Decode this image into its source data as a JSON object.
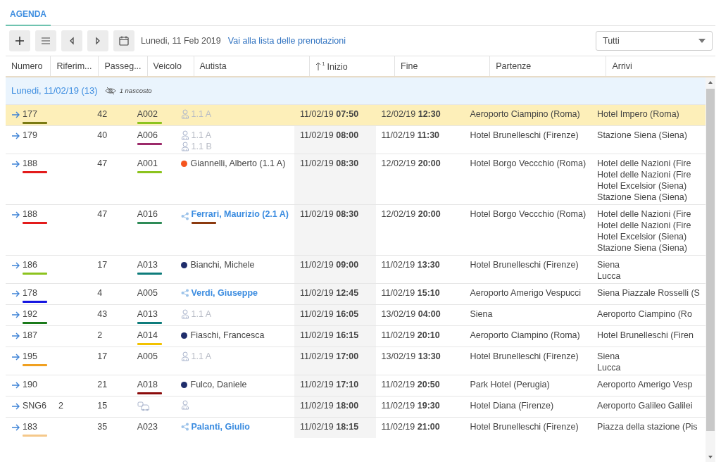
{
  "tabs": [
    {
      "label": "AGENDA",
      "selected": true
    }
  ],
  "toolbar": {
    "date": "Lunedi, 11 Feb 2019",
    "link": "Vai alla lista delle prenotazioni",
    "filter": "Tutti"
  },
  "table": {
    "columns": [
      {
        "label": "Numero"
      },
      {
        "label": "Riferim..."
      },
      {
        "label": "Passeg..."
      },
      {
        "label": "Veicolo"
      },
      {
        "label": "Autista"
      },
      {
        "label": "Inizio",
        "sort_order": "1"
      },
      {
        "label": "Fine"
      },
      {
        "label": "Partenze"
      },
      {
        "label": "Arrivi"
      }
    ],
    "group": {
      "label": "Lunedi, 11/02/19 (13)",
      "hidden": "1 nascosto"
    },
    "rows": [
      {
        "number": {
          "text": "177",
          "color": "#7a7a12"
        },
        "reference": "",
        "passengers": "42",
        "vehicle": {
          "kind": "code",
          "code": "A002",
          "color": "#8cc31e"
        },
        "driver": {
          "kind": "placeholder",
          "slots": [
            "1.1 A"
          ]
        },
        "start": "11/02/19 **07:50**",
        "end": "12/02/19 **12:30**",
        "departure": "Aeroporto Ciampino (Roma)",
        "arrivals": [
          "Hotel Impero (Roma)"
        ],
        "selected": true
      },
      {
        "number": {
          "text": "179"
        },
        "reference": "",
        "passengers": "40",
        "vehicle": {
          "kind": "code",
          "code": "A006",
          "color": "#9c2a6a"
        },
        "driver": {
          "kind": "placeholder",
          "slots": [
            "1.1 A",
            "1.1 B"
          ]
        },
        "start": "11/02/19 **08:00**",
        "end": "11/02/19 **11:30**",
        "departure": "Hotel Brunelleschi (Firenze)",
        "arrivals": [
          "Stazione Siena (Siena)"
        ],
        "selected": false
      },
      {
        "number": {
          "text": "188",
          "color": "#e31b1b"
        },
        "reference": "",
        "passengers": "47",
        "vehicle": {
          "kind": "code",
          "code": "A001",
          "color": "#8cc31e"
        },
        "driver": {
          "kind": "person",
          "name": "Giannelli, Alberto (1.1 A)",
          "color": "#f5541d"
        },
        "start": "11/02/19 **08:30**",
        "end": "12/02/19 **20:00**",
        "departure": "Hotel Borgo Veccchio (Roma)",
        "arrivals": [
          "Hotel delle Nazioni (Fire",
          "Hotel delle Nazioni (Fire",
          "Hotel Excelsior (Siena)",
          "Stazione Siena (Siena)"
        ],
        "selected": false
      },
      {
        "number": {
          "text": "188",
          "color": "#e31b1b"
        },
        "reference": "",
        "passengers": "47",
        "vehicle": {
          "kind": "code",
          "code": "A016",
          "color": "#2e8b57"
        },
        "driver": {
          "kind": "shared",
          "name": "Ferrari, Maurizio (2.1 A)",
          "color": "#8b3a0f"
        },
        "start": "11/02/19 **08:30**",
        "end": "12/02/19 **20:00**",
        "departure": "Hotel Borgo Veccchio (Roma)",
        "arrivals": [
          "Hotel delle Nazioni (Fire",
          "Hotel delle Nazioni (Fire",
          "Hotel Excelsior (Siena)",
          "Stazione Siena (Siena)"
        ],
        "selected": false
      },
      {
        "number": {
          "text": "186",
          "color": "#8cc31e"
        },
        "reference": "",
        "passengers": "17",
        "vehicle": {
          "kind": "code",
          "code": "A013",
          "color": "#0e7c7b"
        },
        "driver": {
          "kind": "person",
          "name": "Bianchi, Michele",
          "color": "#1f2d6b"
        },
        "start": "11/02/19 **09:00**",
        "end": "11/02/19 **13:30**",
        "departure": "Hotel Brunelleschi (Firenze)",
        "arrivals": [
          "Siena",
          "Lucca"
        ],
        "selected": false
      },
      {
        "number": {
          "text": "178",
          "color": "#1414e0"
        },
        "reference": "",
        "passengers": "4",
        "vehicle": {
          "kind": "code",
          "code": "A005"
        },
        "driver": {
          "kind": "shared",
          "name": "Verdi, Giuseppe"
        },
        "start": "11/02/19 **12:45**",
        "end": "11/02/19 **15:10**",
        "departure": "Aeroporto Amerigo Vespucci",
        "arrivals": [
          "Siena Piazzale Rosselli (S"
        ],
        "selected": false
      },
      {
        "number": {
          "text": "192",
          "color": "#1a7a1a"
        },
        "reference": "",
        "passengers": "43",
        "vehicle": {
          "kind": "code",
          "code": "A013",
          "color": "#0e7c7b"
        },
        "driver": {
          "kind": "placeholder",
          "slots": [
            "1.1 A"
          ]
        },
        "start": "11/02/19 **16:05**",
        "end": "13/02/19 **04:00**",
        "departure": "Siena",
        "arrivals": [
          "Aeroporto Ciampino (Ro"
        ],
        "selected": false
      },
      {
        "number": {
          "text": "187"
        },
        "reference": "",
        "passengers": "2",
        "vehicle": {
          "kind": "code",
          "code": "A014",
          "color": "#f2c200"
        },
        "driver": {
          "kind": "person",
          "name": "Fiaschi, Francesca",
          "color": "#1f2d6b"
        },
        "start": "11/02/19 **16:15**",
        "end": "11/02/19 **20:10**",
        "departure": "Aeroporto Ciampino (Roma)",
        "arrivals": [
          "Hotel Brunelleschi (Firen"
        ],
        "selected": false
      },
      {
        "number": {
          "text": "195",
          "color": "#f0a020"
        },
        "reference": "",
        "passengers": "17",
        "vehicle": {
          "kind": "code",
          "code": "A005"
        },
        "driver": {
          "kind": "placeholder",
          "slots": [
            "1.1 A"
          ]
        },
        "start": "11/02/19 **17:00**",
        "end": "13/02/19 **13:30**",
        "departure": "Hotel Brunelleschi (Firenze)",
        "arrivals": [
          "Siena",
          "Lucca"
        ],
        "selected": false
      },
      {
        "number": {
          "text": "190"
        },
        "reference": "",
        "passengers": "21",
        "vehicle": {
          "kind": "code",
          "code": "A018",
          "color": "#8b0a0a"
        },
        "driver": {
          "kind": "person",
          "name": "Fulco, Daniele",
          "color": "#1f2d6b"
        },
        "start": "11/02/19 **17:10**",
        "end": "11/02/19 **20:50**",
        "departure": "Park Hotel (Perugia)",
        "arrivals": [
          "Aeroporto Amerigo Vesp"
        ],
        "selected": false
      },
      {
        "number": {
          "text": "SNG6"
        },
        "reference": "2",
        "passengers": "15",
        "vehicle": {
          "kind": "unassigned"
        },
        "driver": {
          "kind": "unassigned"
        },
        "start": "11/02/19 **18:00**",
        "end": "11/02/19 **19:30**",
        "departure": "Hotel Diana (Firenze)",
        "arrivals": [
          "Aeroporto Galileo Galilei"
        ],
        "selected": false
      },
      {
        "number": {
          "text": "183",
          "color": "#f5c88a"
        },
        "reference": "",
        "passengers": "35",
        "vehicle": {
          "kind": "code",
          "code": "A023"
        },
        "driver": {
          "kind": "shared",
          "name": "Palanti, Giulio"
        },
        "start": "11/02/19 **18:15**",
        "end": "11/02/19 **21:00**",
        "departure": "Hotel Brunelleschi (Firenze)",
        "arrivals": [
          "Piazza della stazione (Pis"
        ],
        "selected": false
      }
    ]
  }
}
